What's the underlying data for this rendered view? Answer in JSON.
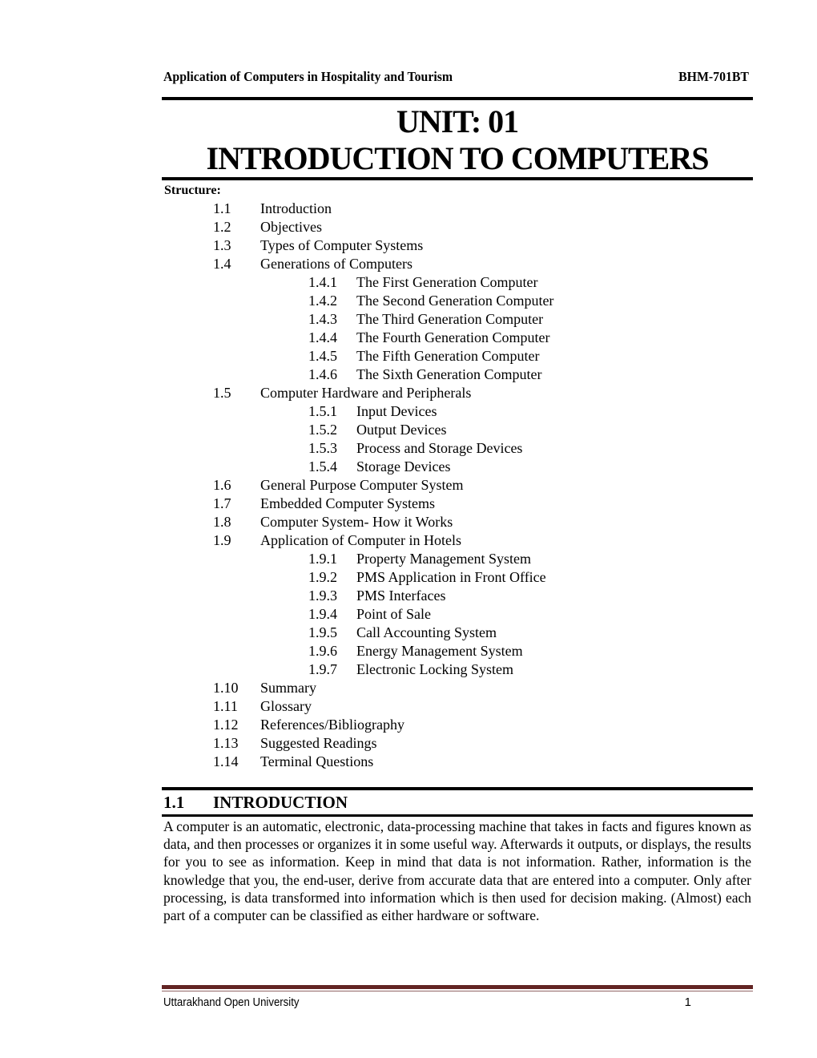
{
  "header": {
    "course_title": "Application of Computers in Hospitality and Tourism",
    "course_code": "BHM-701BT"
  },
  "unit": {
    "title": "UNIT: 01",
    "subtitle": "INTRODUCTION TO COMPUTERS"
  },
  "structure": {
    "label": "Structure:",
    "items": [
      {
        "num": "1.1",
        "text": "Introduction",
        "level": 1
      },
      {
        "num": "1.2",
        "text": "Objectives",
        "level": 1
      },
      {
        "num": "1.3",
        "text": "Types of Computer Systems",
        "level": 1
      },
      {
        "num": "1.4",
        "text": "Generations of Computers",
        "level": 1
      },
      {
        "num": "1.4.1",
        "text": "The First Generation Computer",
        "level": 2
      },
      {
        "num": "1.4.2",
        "text": "The Second Generation Computer",
        "level": 2
      },
      {
        "num": "1.4.3",
        "text": "The Third Generation Computer",
        "level": 2
      },
      {
        "num": "1.4.4",
        "text": "The Fourth Generation Computer",
        "level": 2
      },
      {
        "num": "1.4.5",
        "text": "The Fifth Generation Computer",
        "level": 2
      },
      {
        "num": "1.4.6",
        "text": "The Sixth Generation Computer",
        "level": 2
      },
      {
        "num": "1.5",
        "text": "Computer Hardware and Peripherals",
        "level": 1
      },
      {
        "num": "1.5.1",
        "text": "Input Devices",
        "level": 2
      },
      {
        "num": "1.5.2",
        "text": "Output Devices",
        "level": 2
      },
      {
        "num": "1.5.3",
        "text": "Process and Storage Devices",
        "level": 2
      },
      {
        "num": "1.5.4",
        "text": "Storage Devices",
        "level": 2
      },
      {
        "num": "1.6",
        "text": "General Purpose Computer System",
        "level": 1
      },
      {
        "num": "1.7",
        "text": "Embedded Computer Systems",
        "level": 1
      },
      {
        "num": "1.8",
        "text": "Computer System- How it Works",
        "level": 1
      },
      {
        "num": "1.9",
        "text": "Application of Computer in Hotels",
        "level": 1
      },
      {
        "num": "1.9.1",
        "text": "Property Management System",
        "level": 2
      },
      {
        "num": "1.9.2",
        "text": "PMS Application in Front Office",
        "level": 2
      },
      {
        "num": "1.9.3",
        "text": "PMS Interfaces",
        "level": 2
      },
      {
        "num": "1.9.4",
        "text": "Point of Sale",
        "level": 2
      },
      {
        "num": "1.9.5",
        "text": "Call Accounting System",
        "level": 2
      },
      {
        "num": "1.9.6",
        "text": "Energy Management System",
        "level": 2
      },
      {
        "num": "1.9.7",
        "text": "Electronic Locking System",
        "level": 2
      },
      {
        "num": "1.10",
        "text": "Summary",
        "level": 1
      },
      {
        "num": "1.11",
        "text": "Glossary",
        "level": 1
      },
      {
        "num": "1.12",
        "text": "References/Bibliography",
        "level": 1
      },
      {
        "num": "1.13",
        "text": "Suggested Readings",
        "level": 1
      },
      {
        "num": "1.14",
        "text": "Terminal Questions",
        "level": 1
      }
    ]
  },
  "section": {
    "num": "1.1",
    "title": "INTRODUCTION",
    "body": "A computer is an automatic, electronic, data-processing machine that takes in facts and figures known as data, and then processes or organizes it in some useful way. Afterwards it outputs, or displays, the results for you to see as information. Keep in mind that data is not information. Rather, information is the knowledge that you, the end-user, derive from accurate data that are entered into a computer. Only after processing, is data transformed into information which is then used for decision making. (Almost) each part of a computer can be classified as either hardware or software."
  },
  "footer": {
    "institution": "Uttarakhand Open University",
    "page_number": "1"
  },
  "colors": {
    "footer_rule": "#622423",
    "text": "#000000"
  }
}
